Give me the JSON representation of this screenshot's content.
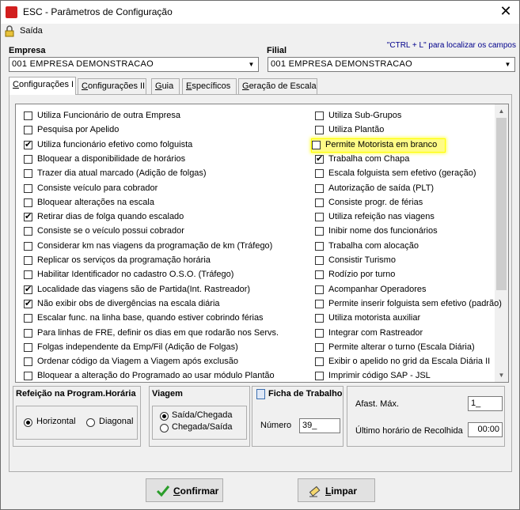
{
  "window": {
    "title": "ESC - Parâmetros de Configuração",
    "close": "✕"
  },
  "menu": {
    "saida": "Saída"
  },
  "empresa": {
    "label": "Empresa",
    "value": "001 EMPRESA DEMONSTRACAO"
  },
  "filial": {
    "label": "Filial",
    "value": "001 EMPRESA DEMONSTRACAO"
  },
  "hint": "\"CTRL + L\" para localizar os campos",
  "tabs": [
    {
      "pre": "",
      "u": "C",
      "post": "onfigurações I"
    },
    {
      "pre": "",
      "u": "C",
      "post": "onfigurações II"
    },
    {
      "pre": "",
      "u": "G",
      "post": "uia"
    },
    {
      "pre": "",
      "u": "E",
      "post": "specíficos"
    },
    {
      "pre": "",
      "u": "G",
      "post": "eração de Escala"
    }
  ],
  "left_options": [
    {
      "label": "Utiliza Funcionário de outra Empresa",
      "checked": false
    },
    {
      "label": "Pesquisa por Apelido",
      "checked": false
    },
    {
      "label": "Utiliza funcionário efetivo como folguista",
      "checked": true
    },
    {
      "label": "Bloquear a disponibilidade de horários",
      "checked": false
    },
    {
      "label": "Trazer dia atual marcado (Adição de folgas)",
      "checked": false
    },
    {
      "label": "Consiste veículo para cobrador",
      "checked": false
    },
    {
      "label": "Bloquear alterações na escala",
      "checked": false
    },
    {
      "label": "Retirar dias de folga quando escalado",
      "checked": true
    },
    {
      "label": "Consiste se o veículo possui cobrador",
      "checked": false
    },
    {
      "label": "Considerar km nas viagens da programação de km (Tráfego)",
      "checked": false
    },
    {
      "label": "Replicar os serviços da programação horária",
      "checked": false
    },
    {
      "label": "Habilitar Identificador no cadastro O.S.O. (Tráfego)",
      "checked": false
    },
    {
      "label": "Localidade das viagens são de Partida(Int. Rastreador)",
      "checked": true
    },
    {
      "label": "Não exibir obs de divergências na escala diária",
      "checked": true
    },
    {
      "label": "Escalar func. na linha base, quando estiver cobrindo férias",
      "checked": false
    },
    {
      "label": "Para linhas de FRE, definir os dias em que rodarão nos Servs.",
      "checked": false
    },
    {
      "label": "Folgas independente da Emp/Fil (Adição de Folgas)",
      "checked": false
    },
    {
      "label": "Ordenar código da Viagem a Viagem após exclusão",
      "checked": false
    },
    {
      "label": "Bloquear a alteração do Programado ao usar módulo Plantão",
      "checked": false
    }
  ],
  "right_options": [
    {
      "label": "Utiliza Sub-Grupos",
      "checked": false
    },
    {
      "label": "Utiliza Plantão",
      "checked": false
    },
    {
      "label": "Permite Motorista em branco",
      "checked": false,
      "highlight": true
    },
    {
      "label": "Trabalha com Chapa",
      "checked": true
    },
    {
      "label": "Escala folguista sem efetivo (geração)",
      "checked": false
    },
    {
      "label": "Autorização de saída (PLT)",
      "checked": false
    },
    {
      "label": "Consiste progr. de férias",
      "checked": false
    },
    {
      "label": "Utiliza refeição nas viagens",
      "checked": false
    },
    {
      "label": "Inibir nome dos funcionários",
      "checked": false
    },
    {
      "label": "Trabalha com alocação",
      "checked": false
    },
    {
      "label": "Consistir Turismo",
      "checked": false
    },
    {
      "label": "Rodízio por turno",
      "checked": false
    },
    {
      "label": "Acompanhar Operadores",
      "checked": false
    },
    {
      "label": "Permite inserir folguista sem efetivo (padrão)",
      "checked": false
    },
    {
      "label": "Utiliza motorista auxiliar",
      "checked": false
    },
    {
      "label": "Integrar com Rastreador",
      "checked": false
    },
    {
      "label": "Permite alterar o turno (Escala Diária)",
      "checked": false
    },
    {
      "label": "Exibir o apelido no grid da Escala Diária II",
      "checked": false
    },
    {
      "label": "Imprimir código SAP - JSL",
      "checked": false
    }
  ],
  "refeicao": {
    "title": "Refeição na Program.Horária",
    "opt1": "Horizontal",
    "opt2": "Diagonal"
  },
  "viagem": {
    "title": "Viagem",
    "opt1": "Saída/Chegada",
    "opt2": "Chegada/Saída"
  },
  "ficha": {
    "title": "Ficha de Trabalho",
    "numero_label": "Número",
    "numero_value": "39_"
  },
  "afast": {
    "label": "Afast. Máx.",
    "value": "1_"
  },
  "recolhida": {
    "label": "Último horário de Recolhida",
    "value": "00:00"
  },
  "buttons": {
    "confirmar_u": "C",
    "confirmar_rest": "onfirmar",
    "limpar_u": "L",
    "limpar_rest": "impar"
  },
  "colors": {
    "check_green": "#2a9d2a",
    "highlight": "#fffb86",
    "hint_blue": "#00008b"
  }
}
